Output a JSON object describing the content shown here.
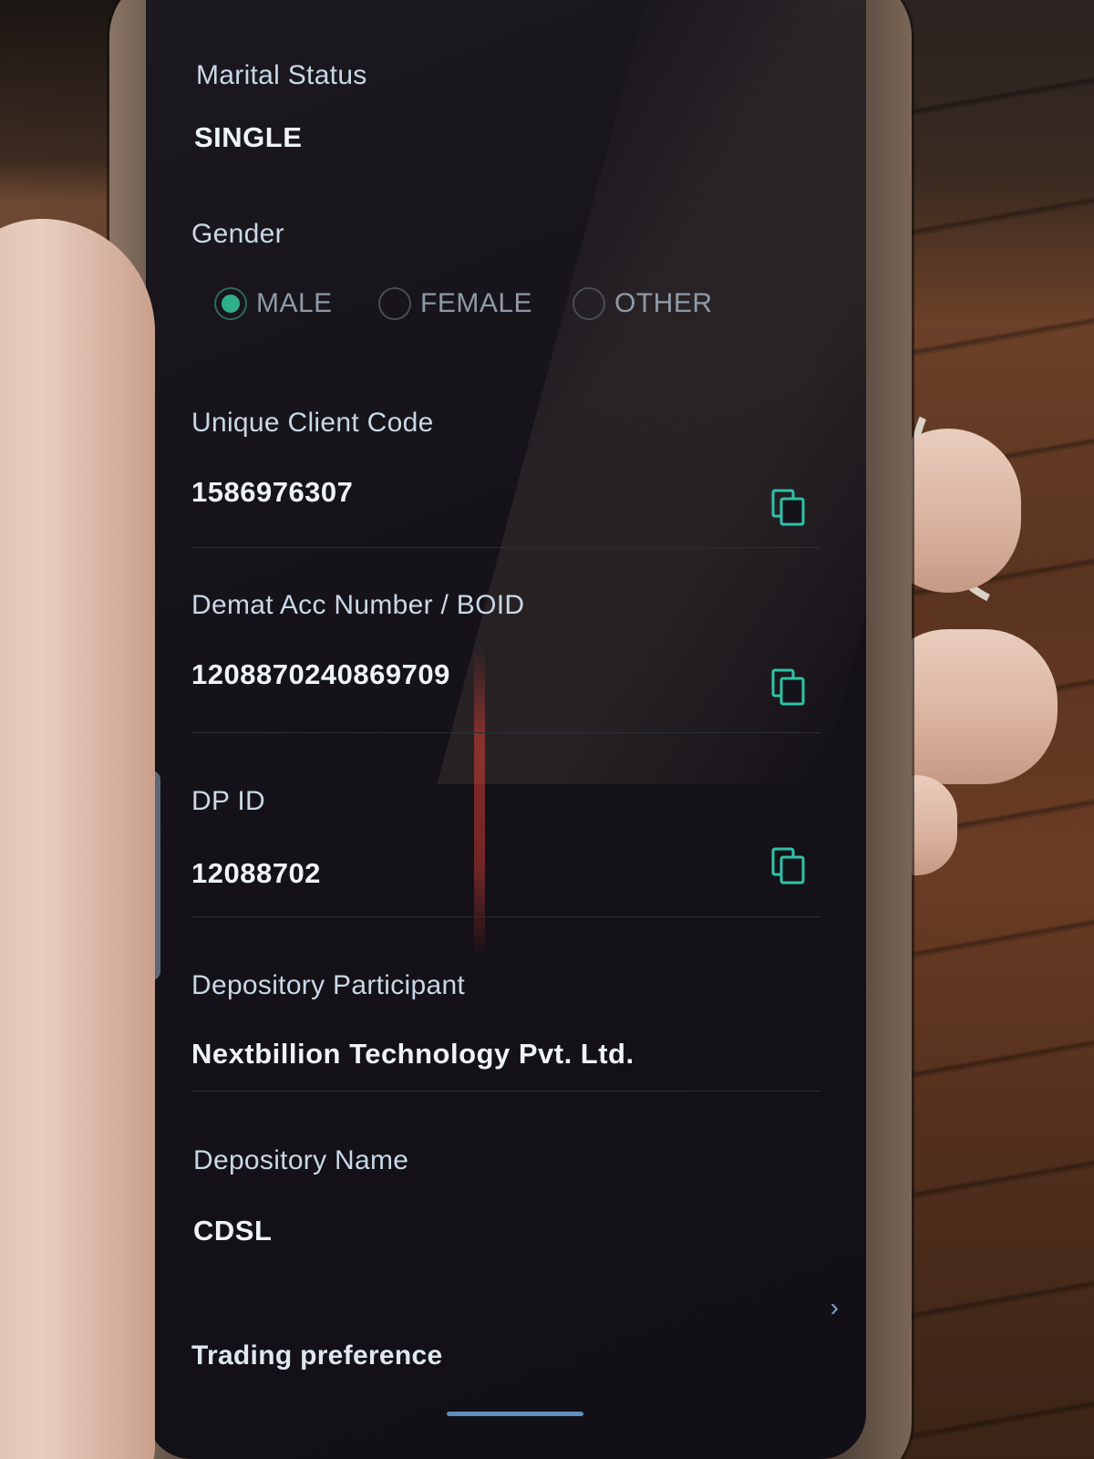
{
  "accent_color": "#2fc2a8",
  "profile": {
    "marital_status": {
      "label": "Marital Status",
      "value": "SINGLE"
    },
    "gender": {
      "label": "Gender",
      "options": [
        {
          "label": "MALE",
          "selected": true
        },
        {
          "label": "FEMALE",
          "selected": false
        },
        {
          "label": "OTHER",
          "selected": false
        }
      ]
    },
    "client_code": {
      "label": "Unique Client Code",
      "value": "1586976307"
    },
    "demat": {
      "label": "Demat Acc Number / BOID",
      "value": "1208870240869709"
    },
    "dp_id": {
      "label": "DP ID",
      "value": "12088702"
    },
    "depository_participant": {
      "label": "Depository Participant",
      "value": "Nextbillion Technology Pvt. Ltd."
    },
    "depository_name": {
      "label": "Depository Name",
      "value": "CDSL"
    },
    "trading_preference": {
      "label": "Trading preference",
      "icon": "chevron-right-icon"
    }
  },
  "icons": {
    "copy": "copy-icon"
  }
}
